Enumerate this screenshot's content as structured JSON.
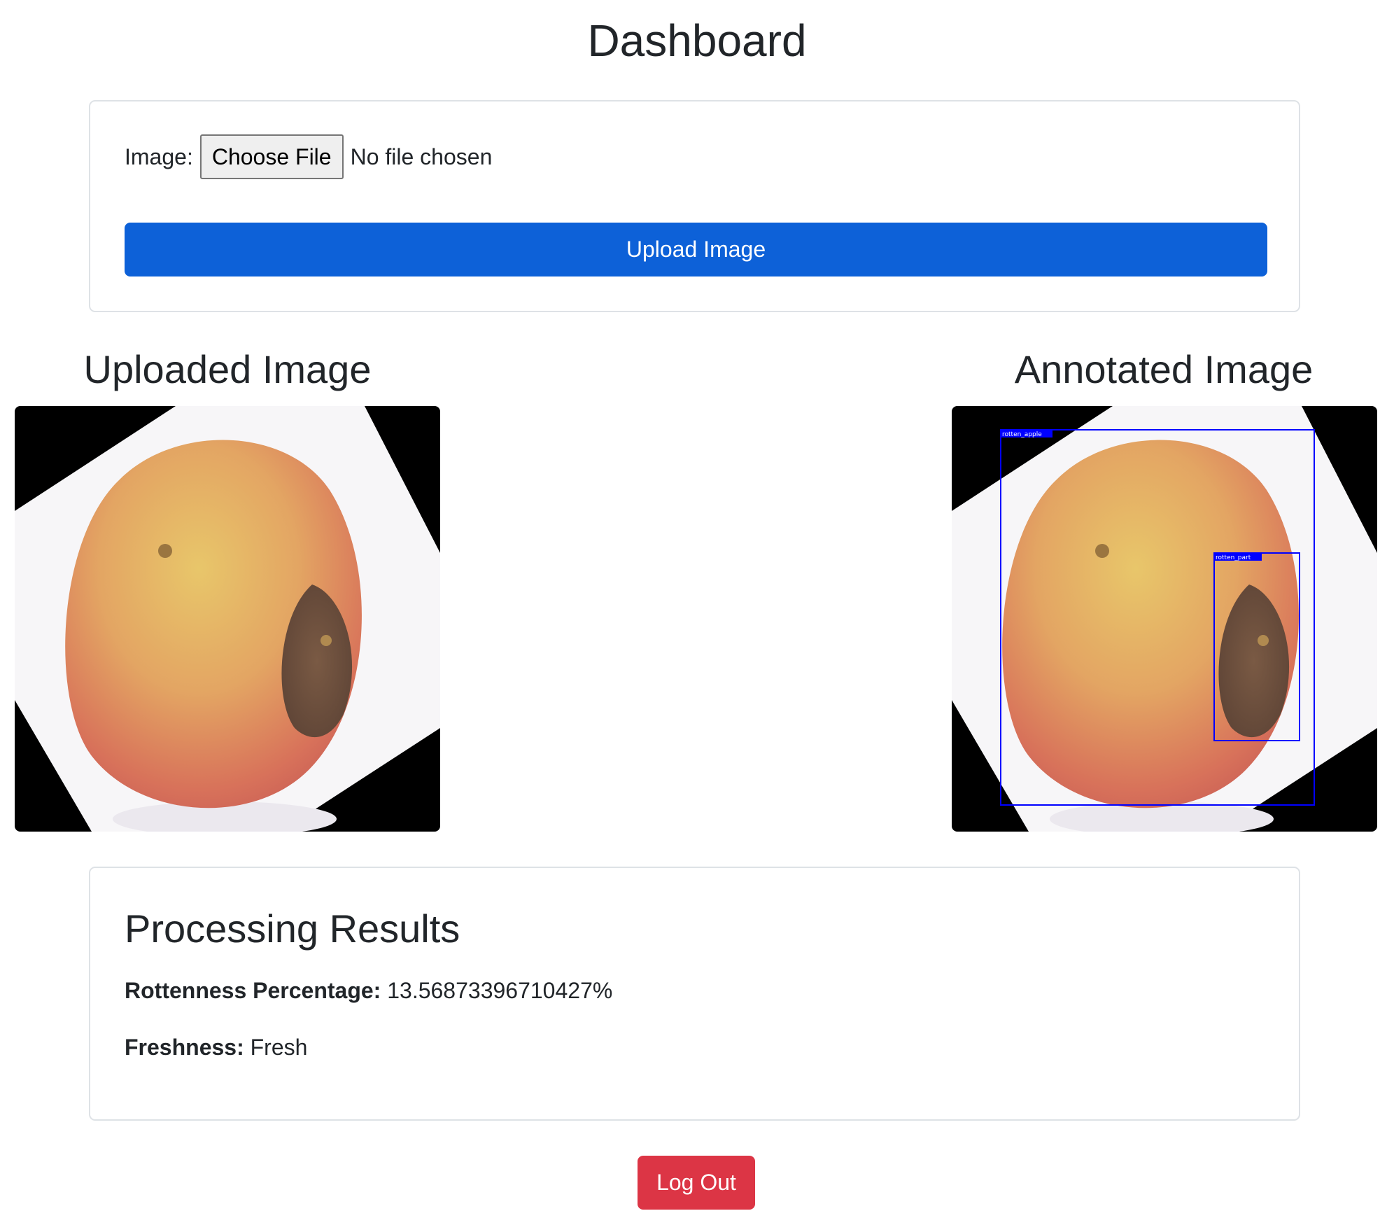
{
  "page": {
    "title": "Dashboard"
  },
  "upload_form": {
    "image_label": "Image:",
    "choose_file_label": "Choose File",
    "file_status": "No file chosen",
    "upload_button_label": "Upload Image"
  },
  "images": {
    "uploaded_heading": "Uploaded Image",
    "annotated_heading": "Annotated Image",
    "annotation_labels": [
      "rotten_apple",
      "rotten_part"
    ],
    "annotation_color": "#0000ff"
  },
  "results": {
    "title": "Processing Results",
    "rottenness_label": "Rottenness Percentage:",
    "rottenness_value": "13.56873396710427%",
    "freshness_label": "Freshness:",
    "freshness_value": "Fresh"
  },
  "actions": {
    "logout_label": "Log Out"
  },
  "colors": {
    "primary": "#0d61d8",
    "danger": "#dc3545",
    "text": "#212529",
    "card_border": "#dee2e6"
  }
}
